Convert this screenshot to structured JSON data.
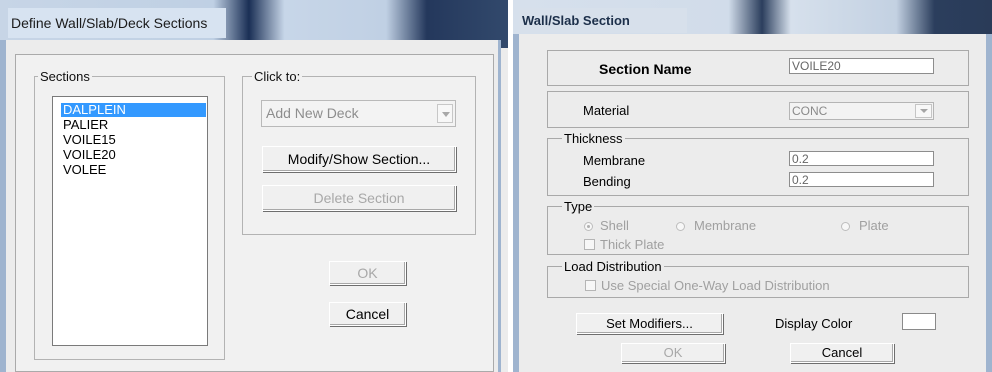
{
  "left_dialog": {
    "title": "Define Wall/Slab/Deck Sections",
    "sections_group": {
      "label": "Sections",
      "items": [
        "DALPLEIN",
        "PALIER",
        "VOILE15",
        "VOILE20",
        "VOLEE"
      ],
      "selected": "DALPLEIN"
    },
    "click_to_group": {
      "label": "Click to:",
      "combo_value": "Add New Deck",
      "modify_label": "Modify/Show Section...",
      "delete_label": "Delete Section"
    },
    "ok_label": "OK",
    "cancel_label": "Cancel"
  },
  "right_dialog": {
    "title": "Wall/Slab Section",
    "section_name_label": "Section Name",
    "section_name_value": "VOILE20",
    "material_label": "Material",
    "material_value": "CONC",
    "thickness": {
      "legend": "Thickness",
      "membrane_label": "Membrane",
      "membrane_value": "0.2",
      "bending_label": "Bending",
      "bending_value": "0.2"
    },
    "type": {
      "legend": "Type",
      "shell_label": "Shell",
      "membrane_label": "Membrane",
      "plate_label": "Plate",
      "thick_plate_label": "Thick Plate",
      "selected": "Shell"
    },
    "load_distribution": {
      "legend": "Load Distribution",
      "checkbox_label": "Use Special One-Way Load Distribution"
    },
    "set_modifiers_label": "Set Modifiers...",
    "display_color_label": "Display Color",
    "display_color_value": "#ffffff",
    "ok_label": "OK",
    "cancel_label": "Cancel"
  },
  "colors": {
    "selection": "#3399ff",
    "dialog_bg": "#ececec",
    "title_dark": "#1a2f55"
  }
}
